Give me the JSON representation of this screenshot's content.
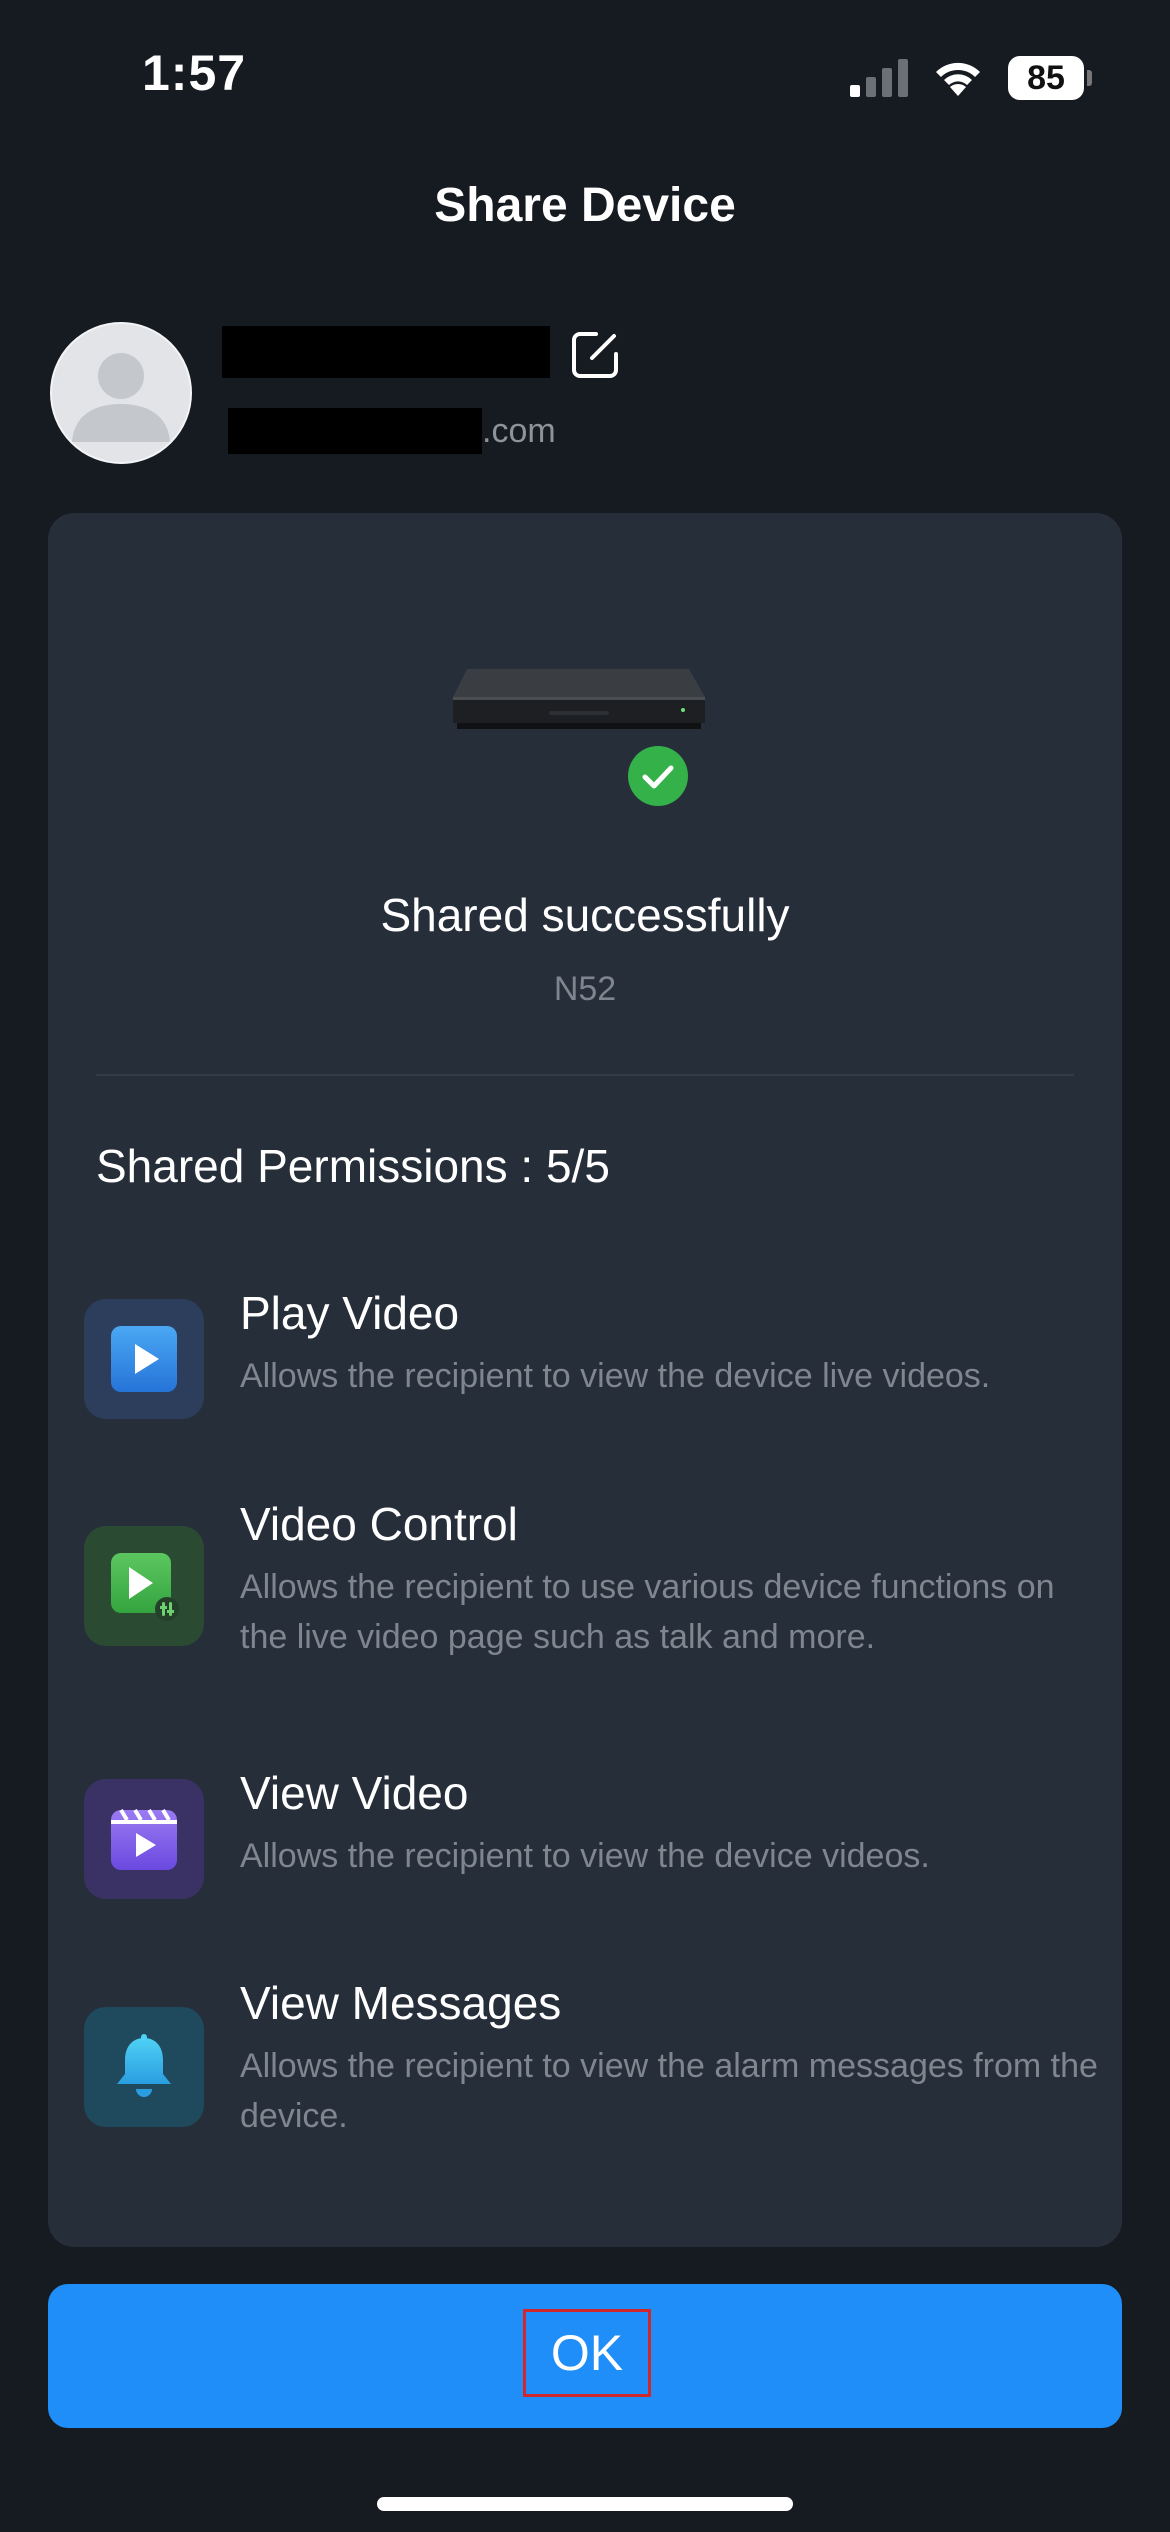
{
  "status_bar": {
    "time": "1:57",
    "battery": "85",
    "icons": [
      "signal-icon",
      "wifi-icon",
      "battery-icon"
    ]
  },
  "header": {
    "title": "Share Device"
  },
  "user": {
    "email_suffix": ".com",
    "icons": [
      "avatar-icon",
      "edit-icon"
    ]
  },
  "device": {
    "status": "Shared successfully",
    "name": "N52",
    "icons": [
      "nvr-device-image",
      "check-icon"
    ]
  },
  "permissions": {
    "heading": "Shared Permissions : 5/5",
    "items": [
      {
        "title": "Play Video",
        "description": "Allows the recipient to view the device live videos.",
        "icon": "play-icon",
        "icon_color": "#3b8fe8"
      },
      {
        "title": "Video Control",
        "description": "Allows the recipient to use various device functions on the live video page such as talk and more.",
        "icon": "video-control-icon",
        "icon_color": "#45b24d"
      },
      {
        "title": "View Video",
        "description": "Allows the recipient to view the device videos.",
        "icon": "clapperboard-icon",
        "icon_color": "#7b5ce8"
      },
      {
        "title": "View Messages",
        "description": "Allows the recipient to view the alarm messages from the device.",
        "icon": "bell-icon",
        "icon_color": "#38b7e8"
      }
    ]
  },
  "footer": {
    "ok_label": "OK"
  },
  "colors": {
    "background": "#161a21",
    "card": "#262e3a",
    "accent": "#1f8ef8",
    "success": "#35b14a",
    "highlight": "#d0272c"
  }
}
